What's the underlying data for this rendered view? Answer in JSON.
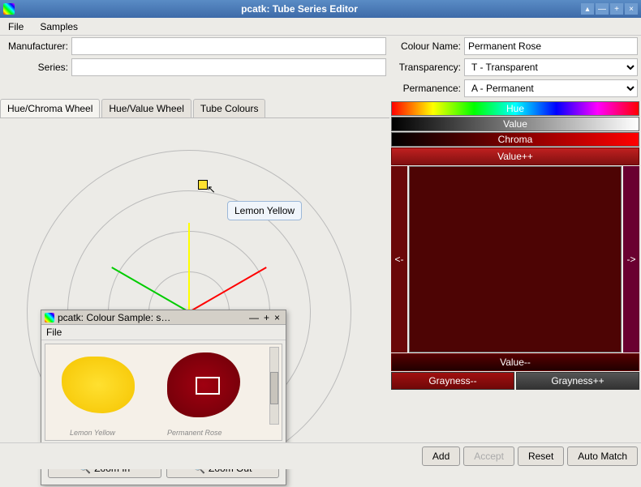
{
  "window": {
    "title": "pcatk: Tube Series Editor"
  },
  "menu": {
    "file": "File",
    "samples": "Samples"
  },
  "fields": {
    "manufacturer_label": "Manufacturer:",
    "manufacturer_value": "",
    "series_label": "Series:",
    "series_value": "",
    "colour_name_label": "Colour Name:",
    "colour_name_value": "Permanent Rose",
    "transparency_label": "Transparency:",
    "transparency_value": "T     - Transparent",
    "permanence_label": "Permanence:",
    "permanence_value": "A     - Permanent"
  },
  "tabs": {
    "hue_chroma": "Hue/Chroma Wheel",
    "hue_value": "Hue/Value Wheel",
    "tube_colours": "Tube Colours"
  },
  "tooltip": "Lemon Yellow",
  "right": {
    "hue": "Hue",
    "value": "Value",
    "chroma": "Chroma",
    "value_plus": "Value++",
    "value_minus": "Value--",
    "left_arrow": "<-",
    "right_arrow": "->",
    "gray_minus": "Grayness--",
    "gray_plus": "Grayness++"
  },
  "buttons": {
    "add": "Add",
    "accept": "Accept",
    "reset": "Reset",
    "auto_match": "Auto Match"
  },
  "dialog": {
    "title": "pcatk: Colour Sample: s…",
    "menu_file": "File",
    "zoom_in": "Zoom In",
    "zoom_out": "Zoom Out",
    "label1": "Lemon Yellow",
    "label2": "Permanent Rose"
  }
}
